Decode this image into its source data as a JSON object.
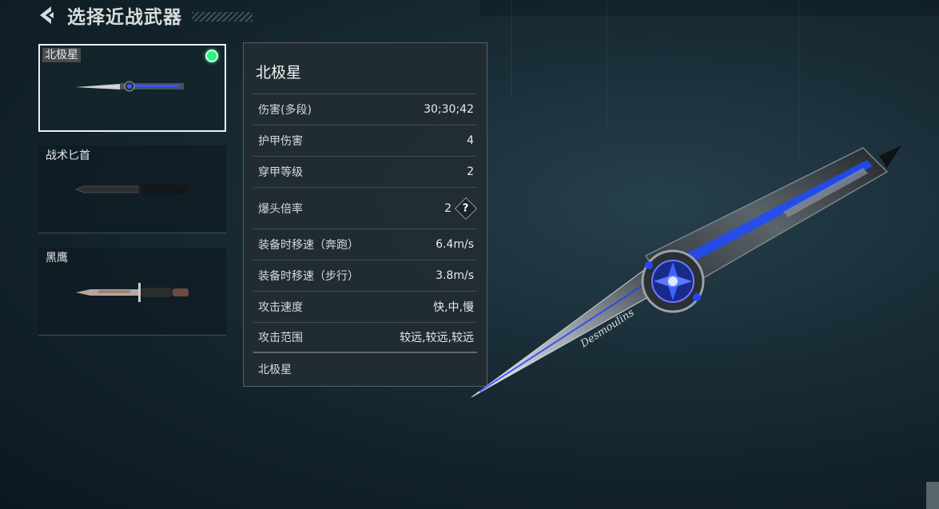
{
  "header": {
    "title": "选择近战武器",
    "back_icon": "back-arrow-icon"
  },
  "weapons": [
    {
      "name": "北极星",
      "selected": true,
      "equipped": true
    },
    {
      "name": "战术匕首",
      "selected": false,
      "equipped": false
    },
    {
      "name": "黑鹰",
      "selected": false,
      "equipped": false
    }
  ],
  "details": {
    "title": "北极星",
    "stats": [
      {
        "label": "伤害(多段)",
        "value": "30;30;42"
      },
      {
        "label": "护甲伤害",
        "value": "4"
      },
      {
        "label": "穿甲等级",
        "value": "2"
      },
      {
        "label": "爆头倍率",
        "value": "2",
        "help": "?"
      },
      {
        "label": "装备时移速（奔跑）",
        "value": "6.4m/s"
      },
      {
        "label": "装备时移速（步行）",
        "value": "3.8m/s"
      },
      {
        "label": "攻击速度",
        "value": "快,中,慢"
      },
      {
        "label": "攻击范围",
        "value": "较远,较远,较远"
      }
    ],
    "footer": "北极星"
  },
  "hero_blade_text": "Desmoulins",
  "colors": {
    "accent_blue": "#2b4dff",
    "equipped_green": "#2ef07e",
    "selected_border": "#eef1f1"
  }
}
